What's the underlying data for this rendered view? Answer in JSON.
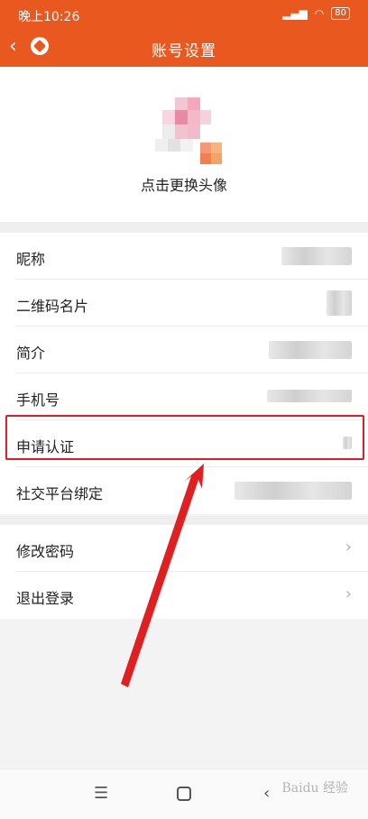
{
  "status_bar": {
    "time": "晚上10:26",
    "battery": "80"
  },
  "header": {
    "title": "账号设置"
  },
  "avatar": {
    "label": "点击更换头像"
  },
  "profile_rows": [
    {
      "label": "昵称"
    },
    {
      "label": "二维码名片"
    },
    {
      "label": "简介"
    },
    {
      "label": "手机号"
    },
    {
      "label": "申请认证"
    },
    {
      "label": "社交平台绑定"
    }
  ],
  "account_rows": [
    {
      "label": "修改密码"
    },
    {
      "label": "退出登录"
    }
  ],
  "watermark": "Baidu 经验",
  "colors": {
    "accent": "#e8581f",
    "highlight": "#e02020"
  }
}
